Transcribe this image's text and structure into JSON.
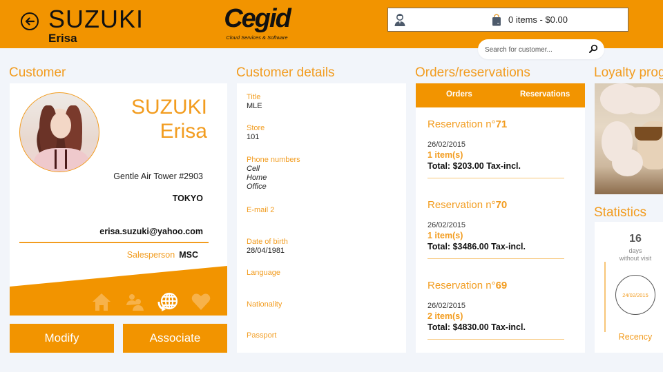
{
  "header": {
    "last_name": "SUZUKI",
    "first_name": "Erisa",
    "logo_word": "Cegid",
    "logo_tagline": "Cloud Services & Software",
    "cart_text": "0 items - $0.00",
    "search_placeholder": "Search for customer..."
  },
  "sections": {
    "customer": "Customer",
    "details": "Customer details",
    "orders": "Orders/reservations",
    "loyalty": "Loyalty prog",
    "statistics": "Statistics"
  },
  "customer": {
    "last_name": "SUZUKI",
    "first_name": "Erisa",
    "address": "Gentle Air Tower #2903",
    "city": "TOKYO",
    "email": "erisa.suzuki@yahoo.com",
    "salesperson_label": "Salesperson",
    "salesperson_value": "MSC",
    "icons": [
      {
        "name": "home-icon",
        "active": false
      },
      {
        "name": "people-icon",
        "active": false
      },
      {
        "name": "globe-sync-icon",
        "active": true
      },
      {
        "name": "heart-icon",
        "active": false
      }
    ],
    "buttons": {
      "modify": "Modify",
      "associate": "Associate"
    }
  },
  "details": {
    "fields": [
      {
        "label": "Title",
        "values": [
          "MLE"
        ]
      },
      {
        "label": "Store",
        "values": [
          "101"
        ]
      },
      {
        "label": "Phone numbers",
        "values": [
          "Cell",
          "Home",
          "Office"
        ]
      },
      {
        "label": "E-mail 2",
        "values": []
      },
      {
        "label": "Date of birth",
        "values": [
          "28/04/1981"
        ]
      },
      {
        "label": "Language",
        "values": []
      },
      {
        "label": "Nationality",
        "values": []
      },
      {
        "label": "Passport",
        "values": []
      }
    ]
  },
  "orders": {
    "tabs": [
      "Orders",
      "Reservations"
    ],
    "reservations": [
      {
        "title_prefix": "Reservation n°",
        "number": "71",
        "date": "26/02/2015",
        "items": "1 item(s)",
        "total": "Total: $203.00 Tax-incl."
      },
      {
        "title_prefix": "Reservation n°",
        "number": "70",
        "date": "26/02/2015",
        "items": "1 item(s)",
        "total": "Total: $3486.00 Tax-incl."
      },
      {
        "title_prefix": "Reservation n°",
        "number": "69",
        "date": "26/02/2015",
        "items": "2 item(s)",
        "total": "Total: $4830.00 Tax-incl."
      }
    ]
  },
  "statistics": {
    "days_value": "16",
    "days_label_1": "days",
    "days_label_2": "without visit",
    "last_visit_date": "24/02/2015",
    "metric_name": "Recency"
  },
  "colors": {
    "accent": "#f29400",
    "accent_text": "#f29c1f",
    "background": "#f2f5fa"
  }
}
